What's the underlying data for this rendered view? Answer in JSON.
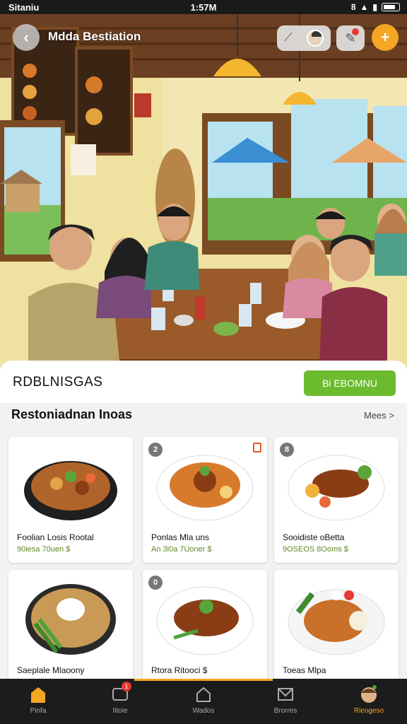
{
  "status": {
    "carrier": "Sitaniu",
    "time": "1:57M",
    "signal": "8"
  },
  "header": {
    "title": "Mdda Bestiation"
  },
  "section": {
    "label": "RDBLNISGAS",
    "cta_label": "Bi EBOMNU"
  },
  "list": {
    "title": "Restoniadnan Inoas",
    "more_label": "Mees >",
    "items": [
      {
        "name": "Foolian Losis Rootal",
        "meta": "90iesa 70uen $",
        "tag": ""
      },
      {
        "name": "Ponlas Mla uns",
        "meta": "An 3l0a 7Uoner $",
        "tag": "2"
      },
      {
        "name": "Sooidiste oBetta",
        "meta": "9OSEOS 8Ooms $",
        "tag": "8"
      },
      {
        "name": "Saeplale Mlaoony",
        "meta": "",
        "tag": ""
      },
      {
        "name": "Rtora Ritooci $",
        "meta": "",
        "tag": "0"
      },
      {
        "name": "Toeas Mlpa",
        "meta": "",
        "tag": ""
      }
    ]
  },
  "nav": {
    "items": [
      {
        "label": "Pinfa",
        "icon": "home-icon"
      },
      {
        "label": "Iitoie",
        "icon": "orders-icon",
        "badge": "1"
      },
      {
        "label": "Wados",
        "icon": "house-icon"
      },
      {
        "label": "Brorres",
        "icon": "inbox-icon"
      },
      {
        "label": "Rieogeso",
        "icon": "profile-icon"
      }
    ]
  },
  "colors": {
    "accent": "#f5a623",
    "cta": "#6cbb2e",
    "nav_bg": "#1c1c1c"
  }
}
